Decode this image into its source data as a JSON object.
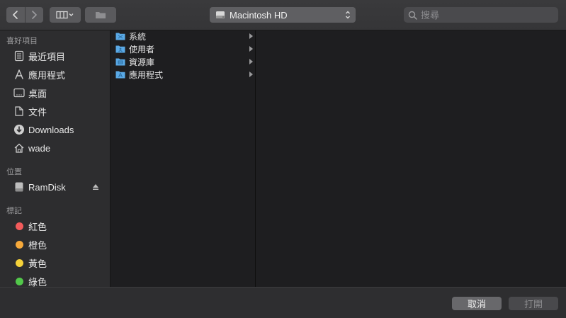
{
  "toolbar": {
    "location": "Macintosh HD",
    "search_placeholder": "搜尋",
    "icons": {
      "back": "chevron-left-icon",
      "forward": "chevron-right-icon",
      "view": "columns-icon",
      "new_folder": "folder-icon",
      "location": "hard-disk-icon",
      "search": "magnifier-icon"
    }
  },
  "sidebar": {
    "favorites_heading": "喜好項目",
    "favorites": [
      {
        "label": "最近項目",
        "icon": "recents-icon"
      },
      {
        "label": "應用程式",
        "icon": "applications-icon"
      },
      {
        "label": "桌面",
        "icon": "desktop-icon"
      },
      {
        "label": "文件",
        "icon": "documents-icon"
      },
      {
        "label": "Downloads",
        "icon": "downloads-icon"
      },
      {
        "label": "wade",
        "icon": "home-icon"
      }
    ],
    "locations_heading": "位置",
    "locations": [
      {
        "label": "RamDisk",
        "icon": "drive-icon",
        "eject": true
      }
    ],
    "tags_heading": "標記",
    "tags": [
      {
        "label": "紅色",
        "color": "#f25b5b"
      },
      {
        "label": "橙色",
        "color": "#f6a93b"
      },
      {
        "label": "黃色",
        "color": "#f5d23a"
      },
      {
        "label": "綠色",
        "color": "#52c84a"
      }
    ]
  },
  "column1": {
    "items": [
      {
        "label": "系統",
        "icon": "system-folder-icon"
      },
      {
        "label": "使用者",
        "icon": "users-folder-icon"
      },
      {
        "label": "資源庫",
        "icon": "library-folder-icon"
      },
      {
        "label": "應用程式",
        "icon": "applications-folder-icon"
      }
    ]
  },
  "footer": {
    "cancel_label": "取消",
    "open_label": "打開"
  },
  "colors": {
    "folder_blue": "#5aa9e6",
    "window_bg": "#1e1e20",
    "sidebar_bg": "#2d2d2f"
  }
}
